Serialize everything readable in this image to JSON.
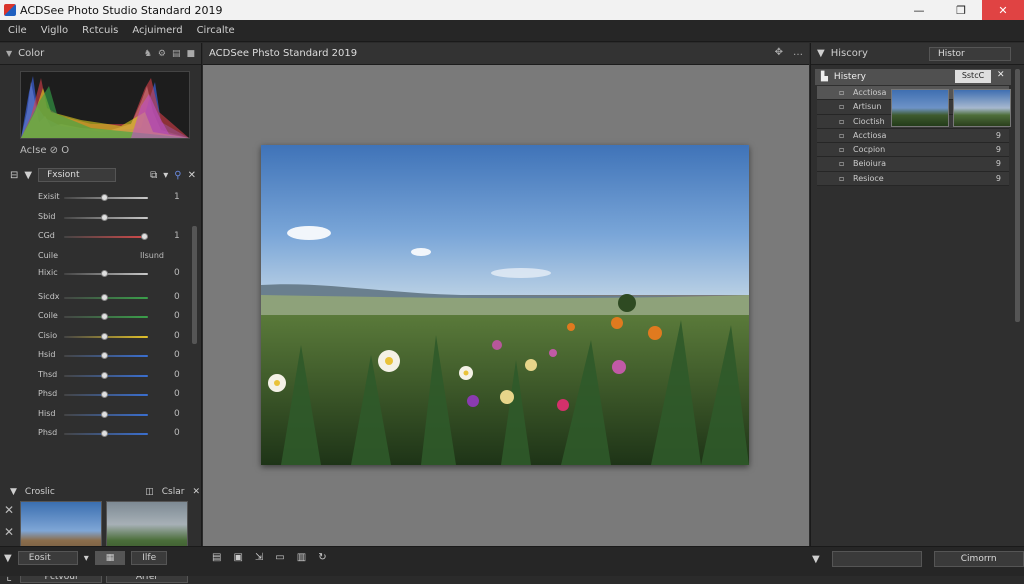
{
  "window": {
    "title": "ACDSee Photo Studio Standard 2019",
    "minimize": "—",
    "restore": "❐",
    "close": "✕"
  },
  "menu": [
    "Cile",
    "Vigllo",
    "Rctcuis",
    "Acjuimerd",
    "Circalte"
  ],
  "left_panel": {
    "histogram_title": "Color",
    "histogram_tools": "AcIse  ⊘  O",
    "adjust_title": "Fxsiont",
    "sliders": [
      {
        "label": "Exisit",
        "value": "1",
        "fill": 0.48,
        "color": "#c9c9c9"
      },
      {
        "label": "Sbid",
        "value": "",
        "fill": 0.48,
        "color": "#c9c9c9"
      },
      {
        "label": "CGd",
        "value": "1",
        "fill": 0.95,
        "color": "#d64a4a"
      },
      {
        "label": "Cuile",
        "value": "Ilsund",
        "fill": 0.0,
        "color": "#555555"
      },
      {
        "label": "Hixic",
        "value": "0",
        "fill": 0.48,
        "color": "#c9c9c9"
      },
      {
        "label": "Sicdx",
        "value": "0",
        "fill": 0.48,
        "color": "#3aa04a"
      },
      {
        "label": "Coile",
        "value": "0",
        "fill": 0.48,
        "color": "#3aa04a"
      },
      {
        "label": "Cisio",
        "value": "0",
        "fill": 0.48,
        "color": "#e2c12a"
      },
      {
        "label": "Hsid",
        "value": "0",
        "fill": 0.48,
        "color": "#3a6fd0"
      },
      {
        "label": "Thsd",
        "value": "0",
        "fill": 0.48,
        "color": "#3a6fd0"
      },
      {
        "label": "Phsd",
        "value": "0",
        "fill": 0.48,
        "color": "#3a6fd0"
      },
      {
        "label": "Hisd",
        "value": "0",
        "fill": 0.48,
        "color": "#3a6fd0"
      },
      {
        "label": "Phsd",
        "value": "0",
        "fill": 0.48,
        "color": "#3a6fd0"
      }
    ],
    "crop_title": "Croslic",
    "crop_color": "Cslar",
    "before_label": "Pctvoul",
    "after_label": "Arfer"
  },
  "center": {
    "title": "ACDSee Phsto Standard 2019"
  },
  "right_panel": {
    "title": "Hiscory",
    "select": "Histor",
    "history_label": "Histery",
    "history_btn": "SstcC",
    "items": [
      {
        "label": "Acctiosa",
        "value": ""
      },
      {
        "label": "Artisun",
        "value": ""
      },
      {
        "label": "Cioctish",
        "value": ""
      },
      {
        "label": "Acctiosa",
        "value": "9"
      },
      {
        "label": "Cocpion",
        "value": "9"
      },
      {
        "label": "Beioiura",
        "value": "9"
      },
      {
        "label": "Resioce",
        "value": "9"
      }
    ]
  },
  "bottom_bar": {
    "left_dropdown": "Eosit",
    "view_btn": "Ilfe",
    "right_btn": "Cimorrn"
  }
}
